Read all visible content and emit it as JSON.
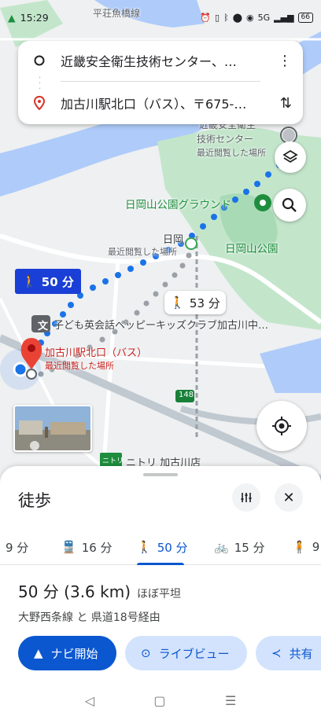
{
  "status": {
    "time": "15:29",
    "network": "5G",
    "battery": "66"
  },
  "search": {
    "origin": "近畿安全衛生技術センター、…",
    "destination": "加古川駅北口（バス）、〒675-…"
  },
  "map_labels": {
    "bridge": "平荘魚橋線",
    "center_line1": "近畿安全衛生",
    "center_line2": "技術センター",
    "center_recent": "最近閲覧した場所",
    "hioka_ground": "日岡山公園グラウンド",
    "hioka_station": "日岡",
    "hioka_recent": "最近閲覧した場所",
    "hioka_park": "日岡山公園",
    "school": "子ども英会話ペッピーキッズクラブ加古川中…",
    "kakogawa": "加古川駅北口（バス）",
    "kakogawa_recent": "最近閲覧した場所",
    "route_no": "148",
    "nitori": "ニトリ 加古川店"
  },
  "route_chips": {
    "selected": "50 分",
    "alternate": "53 分"
  },
  "sheet": {
    "title": "徒歩",
    "tabs": [
      {
        "label": "9 分",
        "icon": "car-icon"
      },
      {
        "label": "16 分",
        "icon": "train-icon"
      },
      {
        "label": "50 分",
        "icon": "walk-icon"
      },
      {
        "label": "15 分",
        "icon": "bike-icon"
      },
      {
        "label": "9",
        "icon": "ride-icon"
      }
    ],
    "duration": "50 分 (3.6 km)",
    "terrain": "ほぼ平坦",
    "via": "大野西条線 と 県道18号経由",
    "start": "ナビ開始",
    "liveview": "ライブビュー",
    "share": "共有"
  },
  "colors": {
    "route_blue": "#1a73e8",
    "accent": "#0b57d0",
    "marker_red": "#ea4335",
    "park_green": "#c3e6cb",
    "water_blue": "#aecbfa"
  }
}
